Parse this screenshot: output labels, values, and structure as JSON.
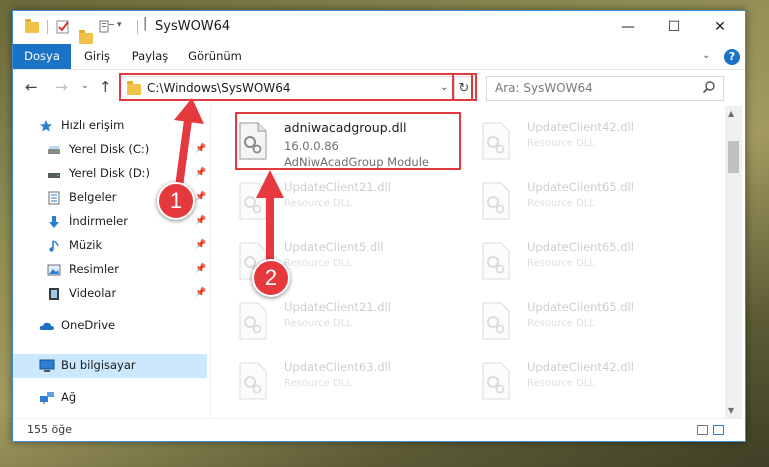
{
  "window": {
    "title": "SysWOW64",
    "controls": {
      "minimize": "—",
      "maximize": "☐",
      "close": "✕"
    }
  },
  "ribbon": {
    "tabs": [
      "Dosya",
      "Giriş",
      "Paylaş",
      "Görünüm"
    ]
  },
  "navigation": {
    "address": "C:\\Windows\\SysWOW64",
    "search_placeholder": "Ara: SysWOW64"
  },
  "sidebar": {
    "items": [
      {
        "label": "Hızlı erişim",
        "icon": "star-icon",
        "pinned": false
      },
      {
        "label": "Yerel Disk (C:)",
        "icon": "drive-icon",
        "pinned": true
      },
      {
        "label": "Yerel Disk (D:)",
        "icon": "drive-icon",
        "pinned": true
      },
      {
        "label": "Belgeler",
        "icon": "documents-icon",
        "pinned": true
      },
      {
        "label": "İndirmeler",
        "icon": "download-icon",
        "pinned": true
      },
      {
        "label": "Müzik",
        "icon": "music-icon",
        "pinned": true
      },
      {
        "label": "Resimler",
        "icon": "pictures-icon",
        "pinned": true
      },
      {
        "label": "Videolar",
        "icon": "video-icon",
        "pinned": true
      },
      {
        "label": "OneDrive",
        "icon": "cloud-icon",
        "pinned": false
      },
      {
        "label": "Bu bilgisayar",
        "icon": "computer-icon",
        "pinned": false,
        "selected": true
      },
      {
        "label": "Ağ",
        "icon": "network-icon",
        "pinned": false
      }
    ]
  },
  "files": {
    "highlighted": {
      "name": "adniwacadgroup.dll",
      "version": "16.0.0.86",
      "description": "AdNiwAcadGroup Module"
    },
    "ghost_items": [
      {
        "name": "UpdateClient42.dll",
        "sub": "Resource DLL"
      },
      {
        "name": "UpdateClient21.dll",
        "sub": "Resource DLL"
      },
      {
        "name": "UpdateClient65.dll",
        "sub": "Resource DLL"
      },
      {
        "name": "UpdateClient5.dll",
        "sub": "Resource DLL"
      },
      {
        "name": "UpdateClient65.dll",
        "sub": "Resource DLL"
      },
      {
        "name": "UpdateClient21.dll",
        "sub": "Resource DLL"
      },
      {
        "name": "UpdateClient65.dll",
        "sub": "Resource DLL"
      },
      {
        "name": "UpdateClient63.dll",
        "sub": "Resource DLL"
      },
      {
        "name": "UpdateClient42.dll",
        "sub": "Resource DLL"
      }
    ]
  },
  "status": {
    "item_count": "155 öğe"
  },
  "annotations": {
    "step1": "1",
    "step2": "2",
    "color": "#e5393e"
  }
}
